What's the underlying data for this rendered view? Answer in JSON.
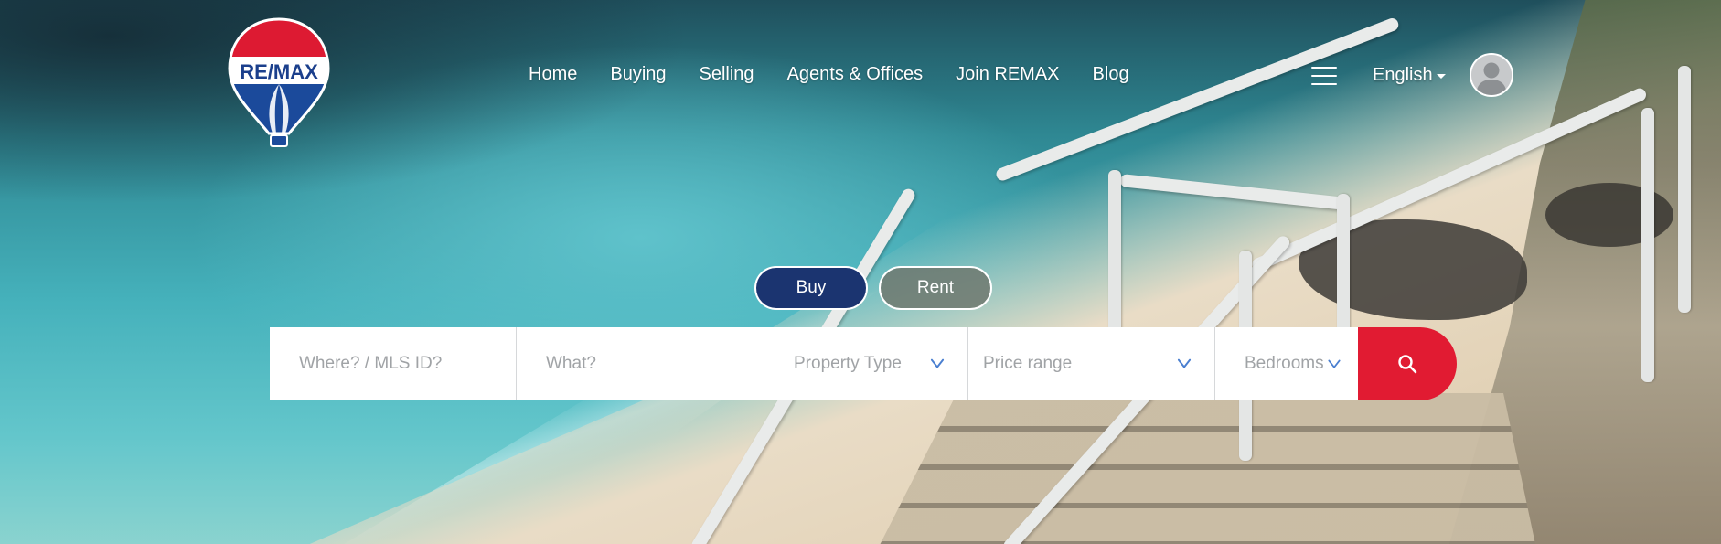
{
  "brand": {
    "logo_text": "RE/MAX"
  },
  "nav": {
    "items": [
      {
        "label": "Home"
      },
      {
        "label": "Buying"
      },
      {
        "label": "Selling"
      },
      {
        "label": "Agents & Offices"
      },
      {
        "label": "Join REMAX"
      },
      {
        "label": "Blog"
      }
    ]
  },
  "header": {
    "language": "English",
    "menu_icon": "hamburger-menu-icon",
    "avatar_icon": "user-avatar-icon"
  },
  "toggle": {
    "buy_label": "Buy",
    "rent_label": "Rent",
    "selected": "Buy"
  },
  "search": {
    "where_placeholder": "Where? / MLS ID?",
    "what_placeholder": "What?",
    "property_type_label": "Property Type",
    "price_range_label": "Price range",
    "bedrooms_label": "Bedrooms",
    "button_icon": "search-icon"
  },
  "colors": {
    "brand_blue": "#1b3470",
    "brand_red": "#e11b32",
    "chevron_blue": "#4a7fd0"
  }
}
